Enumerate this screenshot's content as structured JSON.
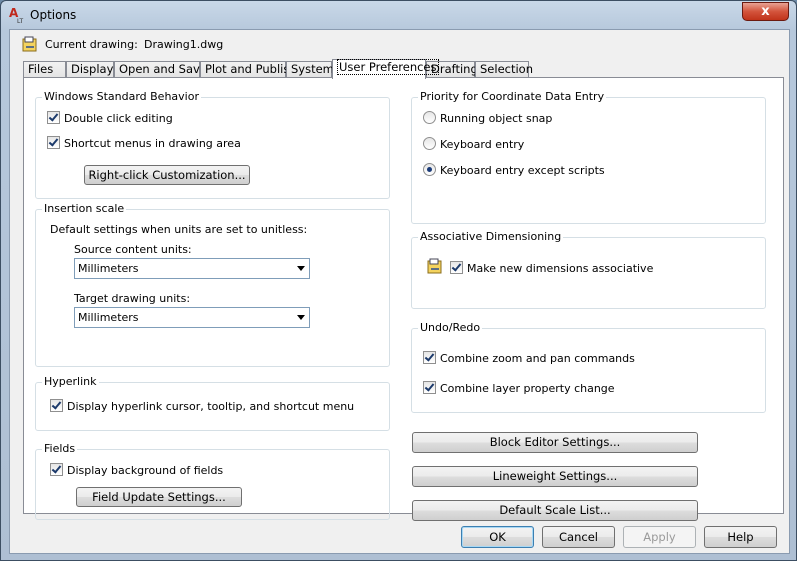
{
  "window": {
    "title": "Options",
    "close_label": "x"
  },
  "drawing": {
    "label": "Current drawing:",
    "value": "Drawing1.dwg"
  },
  "tabs": [
    {
      "label": "Files"
    },
    {
      "label": "Display"
    },
    {
      "label": "Open and Save"
    },
    {
      "label": "Plot and Publish"
    },
    {
      "label": "System"
    },
    {
      "label": "User Preferences"
    },
    {
      "label": "Drafting"
    },
    {
      "label": "Selection"
    }
  ],
  "windows_behavior": {
    "title": "Windows Standard Behavior",
    "double_click": {
      "label": "Double click editing",
      "checked": true
    },
    "shortcut_menus": {
      "label": "Shortcut menus in drawing area",
      "checked": true
    },
    "right_click_button": "Right-click Customization..."
  },
  "insertion_scale": {
    "title": "Insertion scale",
    "description": "Default settings when units are set to unitless:",
    "source_label": "Source content units:",
    "source_value": "Millimeters",
    "target_label": "Target drawing units:",
    "target_value": "Millimeters"
  },
  "hyperlink": {
    "title": "Hyperlink",
    "display": {
      "label": "Display hyperlink cursor, tooltip, and shortcut menu",
      "checked": true
    }
  },
  "fields": {
    "title": "Fields",
    "display_background": {
      "label": "Display background of fields",
      "checked": true
    },
    "update_button": "Field Update Settings..."
  },
  "priority": {
    "title": "Priority for Coordinate Data Entry",
    "options": [
      {
        "label": "Running object snap",
        "selected": false
      },
      {
        "label": "Keyboard entry",
        "selected": false
      },
      {
        "label": "Keyboard entry except scripts",
        "selected": true
      }
    ]
  },
  "assoc_dim": {
    "title": "Associative Dimensioning",
    "make_assoc": {
      "label": "Make new dimensions associative",
      "checked": true
    }
  },
  "undo_redo": {
    "title": "Undo/Redo",
    "combine_zoom": {
      "label": "Combine zoom and pan commands",
      "checked": true
    },
    "combine_layer": {
      "label": "Combine layer property change",
      "checked": true
    }
  },
  "side_buttons": {
    "block_editor": "Block Editor Settings...",
    "lineweight": "Lineweight Settings...",
    "scale_list": "Default Scale List..."
  },
  "footer": {
    "ok": "OK",
    "cancel": "Cancel",
    "apply": "Apply",
    "help": "Help"
  }
}
